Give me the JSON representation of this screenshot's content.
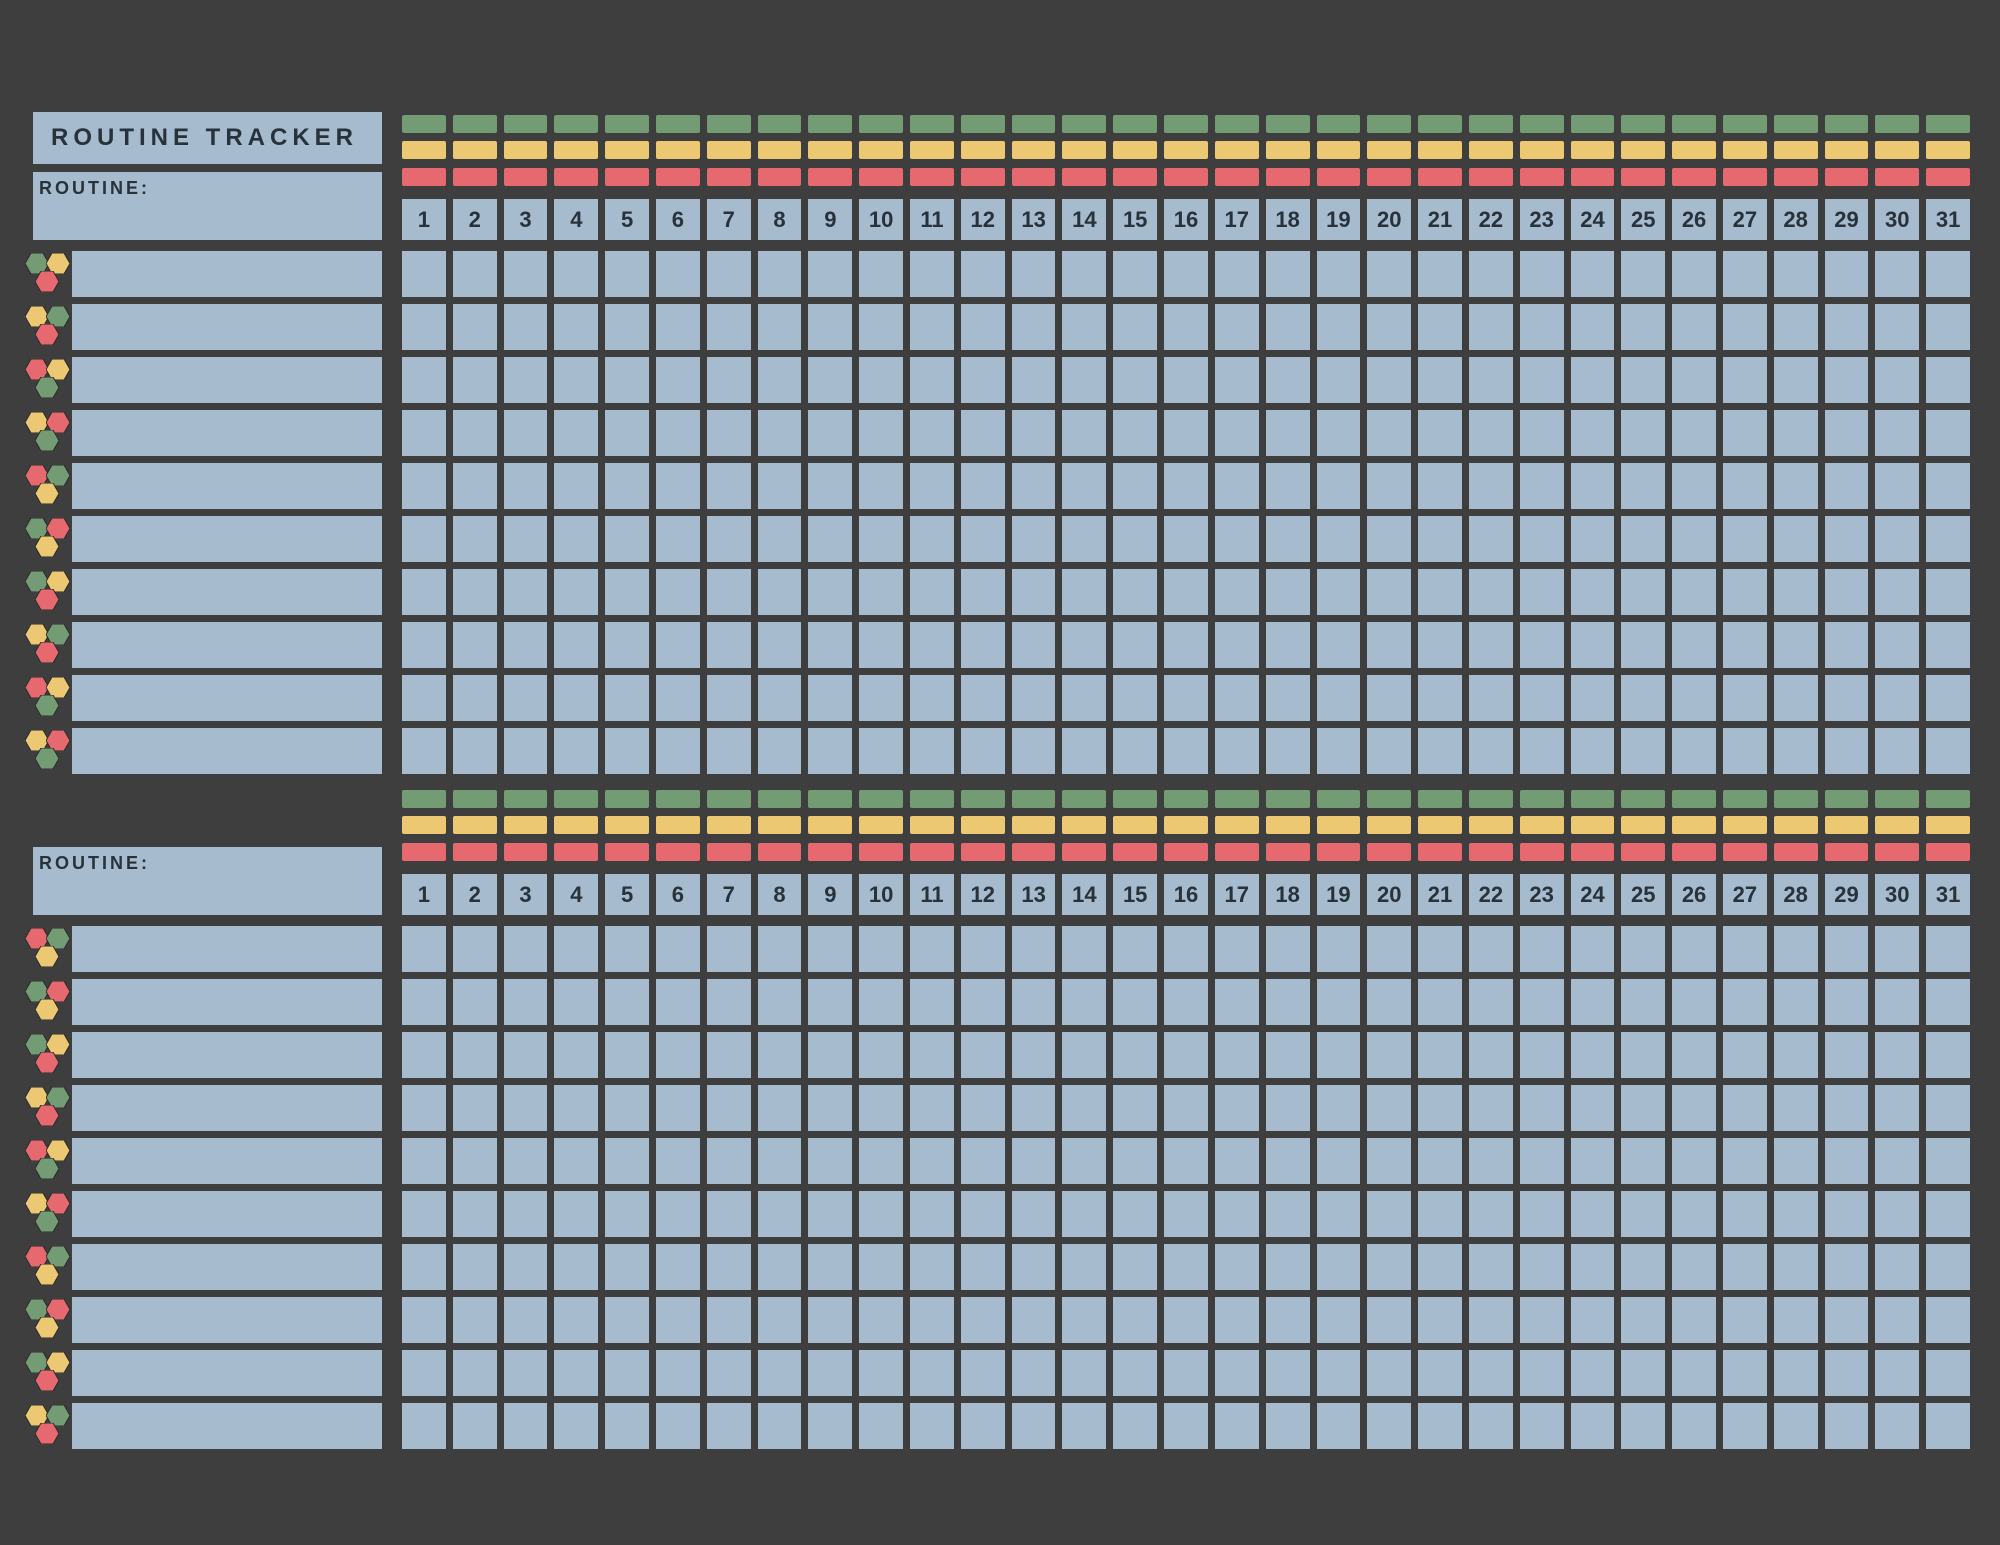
{
  "title": "ROUTINE TRACKER",
  "routine_label": "ROUTINE:",
  "days": [
    "1",
    "2",
    "3",
    "4",
    "5",
    "6",
    "7",
    "8",
    "9",
    "10",
    "11",
    "12",
    "13",
    "14",
    "15",
    "16",
    "17",
    "18",
    "19",
    "20",
    "21",
    "22",
    "23",
    "24",
    "25",
    "26",
    "27",
    "28",
    "29",
    "30",
    "31"
  ],
  "colors": {
    "blue": "#a6bbce",
    "green": "#749c74",
    "yellow": "#edc873",
    "red": "#e5696e",
    "bg": "#3e3e3e"
  },
  "sections": [
    {
      "routine_name": "",
      "rows": 10,
      "hex_patterns": [
        [
          "green",
          "yellow",
          "red"
        ],
        [
          "yellow",
          "green",
          "red"
        ],
        [
          "red",
          "yellow",
          "green"
        ],
        [
          "yellow",
          "red",
          "green"
        ],
        [
          "red",
          "green",
          "yellow"
        ],
        [
          "green",
          "red",
          "yellow"
        ],
        [
          "green",
          "yellow",
          "red"
        ],
        [
          "yellow",
          "green",
          "red"
        ],
        [
          "red",
          "yellow",
          "green"
        ],
        [
          "yellow",
          "red",
          "green"
        ]
      ]
    },
    {
      "routine_name": "",
      "rows": 10,
      "hex_patterns": [
        [
          "red",
          "green",
          "yellow"
        ],
        [
          "green",
          "red",
          "yellow"
        ],
        [
          "green",
          "yellow",
          "red"
        ],
        [
          "yellow",
          "green",
          "red"
        ],
        [
          "red",
          "yellow",
          "green"
        ],
        [
          "yellow",
          "red",
          "green"
        ],
        [
          "red",
          "green",
          "yellow"
        ],
        [
          "green",
          "red",
          "yellow"
        ],
        [
          "green",
          "yellow",
          "red"
        ],
        [
          "yellow",
          "green",
          "red"
        ]
      ]
    }
  ]
}
